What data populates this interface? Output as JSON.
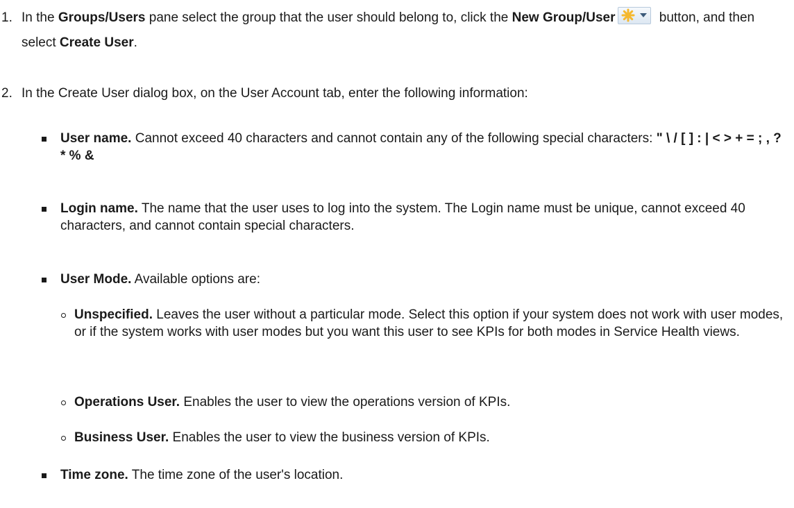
{
  "steps": [
    {
      "num": "1.",
      "pre": "In the ",
      "pane": "Groups/Users",
      "mid1": " pane select the group that the user should belong to, click the ",
      "btn_name": "New Group/User",
      "mid2": " button, and then select ",
      "action": "Create User",
      "post": "."
    },
    {
      "num": "2.",
      "text": "In the Create User dialog box, on the User Account tab, enter the following information:"
    }
  ],
  "fields": [
    {
      "term": "User name.",
      "desc": " Cannot exceed 40 characters and cannot contain any of the following special characters: ",
      "special": "\" \\ / [ ] : | < > + = ; , ? * % &"
    },
    {
      "term": "Login name.",
      "desc": " The name that the user uses to log into the system. The Login name must be unique, cannot exceed 40 characters, and cannot contain special characters."
    },
    {
      "term": "User Mode.",
      "desc": " Available options are:"
    },
    {
      "term": "Time zone.",
      "desc": " The time zone of the user's location."
    }
  ],
  "modes": [
    {
      "term": "Unspecified.",
      "desc": " Leaves the user without a particular mode. Select this option if your system does not work with user modes, or if the system works with user modes but you want this user to see KPIs for both modes in Service Health views."
    },
    {
      "term": "Operations User.",
      "desc": " Enables the user to view the operations version of KPIs."
    },
    {
      "term": "Business User.",
      "desc": " Enables the user to view the business version of KPIs."
    }
  ],
  "icons": {
    "new_group_user_button": "star-with-dropdown-icon",
    "star_color": "#f5b82e",
    "button_border": "#b7c9dc"
  }
}
